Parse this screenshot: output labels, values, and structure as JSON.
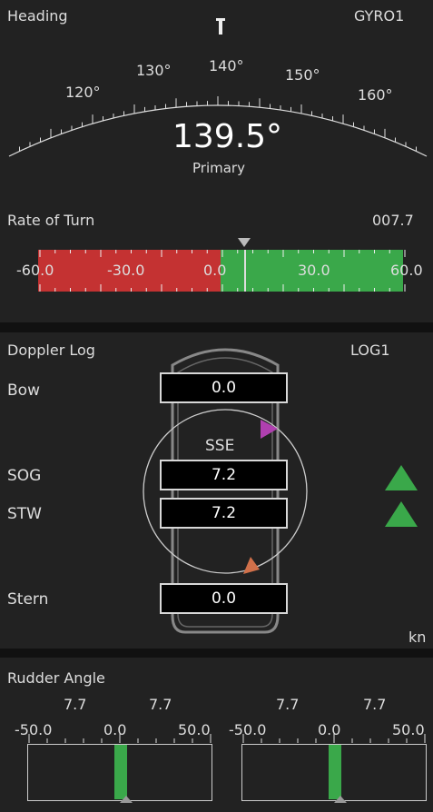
{
  "heading": {
    "title": "Heading",
    "source": "GYRO1",
    "value": "139.5°",
    "mode": "Primary",
    "scale_ticks": [
      "120°",
      "130°",
      "140°",
      "150°",
      "160°"
    ]
  },
  "rate_of_turn": {
    "title": "Rate of Turn",
    "value": "007.7",
    "ticks": [
      "-60.0",
      "-30.0",
      "0.0",
      "30.0",
      "60.0"
    ],
    "colors": {
      "negative": "#c43232",
      "positive": "#3aa84a"
    }
  },
  "doppler_log": {
    "title": "Doppler Log",
    "source": "LOG1",
    "direction": "SSE",
    "unit": "kn",
    "rows": [
      {
        "label": "Bow",
        "value": "0.0"
      },
      {
        "label": "SOG",
        "value": "7.2"
      },
      {
        "label": "STW",
        "value": "7.2"
      },
      {
        "label": "Stern",
        "value": "0.0"
      }
    ],
    "colors": {
      "sog_marker": "#b040b0",
      "stw_marker": "#d0704a",
      "trend_arrow": "#3aa84a"
    }
  },
  "rudder": {
    "title": "Rudder Angle",
    "values": [
      "7.7",
      "7.7",
      "7.7",
      "7.7"
    ],
    "ticks": [
      "-50.0",
      "0.0",
      "50.0"
    ],
    "color": "#3aa84a"
  }
}
